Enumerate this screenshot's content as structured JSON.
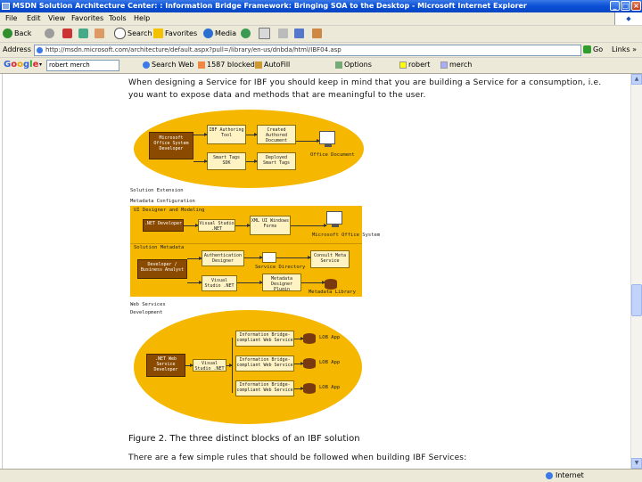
{
  "window": {
    "title": "MSDN Solution Architecture Center: : Information Bridge Framework: Bringing SOA to the Desktop - Microsoft Internet Explorer"
  },
  "menu": [
    "File",
    "Edit",
    "View",
    "Favorites",
    "Tools",
    "Help"
  ],
  "toolbar": {
    "back": "Back",
    "search": "Search",
    "favorites": "Favorites",
    "media": "Media"
  },
  "address": {
    "label": "Address",
    "url": "http://msdn.microsoft.com/architecture/default.aspx?pull=/library/en-us/dnbda/html/IBF04.asp",
    "go": "Go",
    "links": "Links"
  },
  "googlebar": {
    "logo": "Google",
    "query": "robert merch",
    "search_web": "Search Web",
    "blocked": "1587 blocked",
    "autofill": "AutoFill",
    "options": "Options",
    "robert": "robert",
    "merch": "merch"
  },
  "page": {
    "intro_line1": "When designing a Service for IBF you should keep in mind that you are building a Service for a consumption, i.e.",
    "intro_line2": "you want to expose data and methods that are meaningful to the user.",
    "diagram1": {
      "actor": "Microsoft Office System Developer",
      "box_a": "IBF Authoring Tool",
      "box_b": "Created Authored Document",
      "box_c": "Smart Tags SDK",
      "box_d": "Deployed Smart Tags",
      "monitor_label": "Office Document"
    },
    "label_solution": "Solution Extension",
    "label_metadata": "Metadata Configuration",
    "diagram2": {
      "header": "UI Designer and Modeling",
      "net_dev": ".NET Developer",
      "visual_studio": "Visual Studio .NET",
      "xml_ui": "XML UI Windows Forms",
      "office_label": "Microsoft Office System",
      "solution_header": "Solution Metadata",
      "analyst": "Developer / Business Analyst",
      "auth_designer": "Authentication Designer",
      "service_dir": "Service Directory",
      "vs_net": "Visual Studio .NET",
      "metadata_plugin": "Metadata Designer Plugin",
      "consult": "Consult Meta Service",
      "metadata_library": "Metadata Library"
    },
    "label_web": "Web Services",
    "label_development": "Development",
    "diagram3": {
      "dev": ".NET Web Service Developer",
      "vs": "Visual Studio .NET",
      "svc1": "Information Bridge-compliant Web Service",
      "svc2": "Information Bridge-compliant Web Service",
      "svc3": "Information Bridge-compliant Web Service",
      "app1": "LOB App",
      "app2": "LOB App",
      "app3": "LOB App"
    },
    "caption": "Figure 2.   The three distinct blocks of an IBF solution",
    "footer_line": "There are a few simple rules that should be followed when building IBF Services:"
  },
  "status": {
    "zone": "Internet"
  },
  "colors": {
    "accent": "#f5b700",
    "titlebar": "#0a4fd6"
  }
}
